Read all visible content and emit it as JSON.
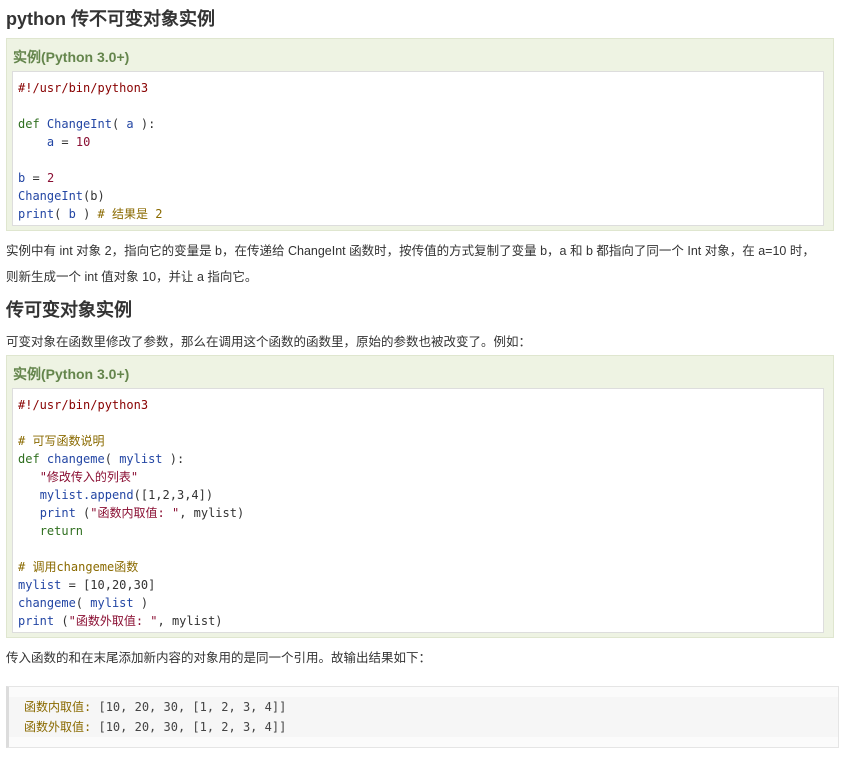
{
  "section1": {
    "heading": "python 传不可变对象实例",
    "example_title": "实例(Python 3.0+)",
    "code": {
      "shebang": "#!/usr/bin/python3",
      "l3_kw": "def",
      "l3_fn": "ChangeInt",
      "l3_open": "(",
      "l3_arg": "a",
      "l3_close": "):",
      "l4_var": "a",
      "l4_eq": "=",
      "l4_num": "10",
      "l6_var": "b",
      "l6_eq": "=",
      "l6_num": "2",
      "l7_fn": "ChangeInt",
      "l7_args": "(b)",
      "l8_fn": "print",
      "l8_open": "(",
      "l8_arg": "b",
      "l8_close": ")",
      "l8_comment": "# 结果是 2"
    },
    "paragraph": "实例中有 int 对象 2，指向它的变量是 b，在传递给 ChangeInt 函数时，按传值的方式复制了变量 b，a 和 b 都指向了同一个 Int 对象，在 a=10 时，则新生成一个 int 值对象 10，并让 a 指向它。"
  },
  "section2": {
    "heading": "传可变对象实例",
    "intro": "可变对象在函数里修改了参数，那么在调用这个函数的函数里，原始的参数也被改变了。例如：",
    "example_title": "实例(Python 3.0+)",
    "code": {
      "shebang": "#!/usr/bin/python3",
      "l3_comment": "# 可写函数说明",
      "l4_kw": "def",
      "l4_fn": "changeme",
      "l4_open": "(",
      "l4_arg": "mylist",
      "l4_close": "):",
      "l5_str": "\"修改传入的列表\"",
      "l6_obj": "mylist",
      "l6_method": ".append",
      "l6_args": "([1,2,3,4])",
      "l7_fn": "print",
      "l7_open": "(",
      "l7_str": "\"函数内取值: \"",
      "l7_rest": ", mylist)",
      "l8_kw": "return",
      "l10_comment": "# 调用changeme函数",
      "l11_var": "mylist",
      "l11_eq": "=",
      "l11_val": "[10,20,30]",
      "l12_fn": "changeme",
      "l12_open": "(",
      "l12_arg": "mylist",
      "l12_close": ")",
      "l13_fn": "print",
      "l13_open": "(",
      "l13_str": "\"函数外取值: \"",
      "l13_rest": ", mylist)"
    },
    "outro": "传入函数的和在末尾添加新内容的对象用的是同一个引用。故输出结果如下：",
    "output": [
      {
        "label": "函数内取值:",
        "value": "[10, 20, 30, [1, 2, 3, 4]]"
      },
      {
        "label": "函数外取值:",
        "value": "[10, 20, 30, [1, 2, 3, 4]]"
      }
    ]
  }
}
